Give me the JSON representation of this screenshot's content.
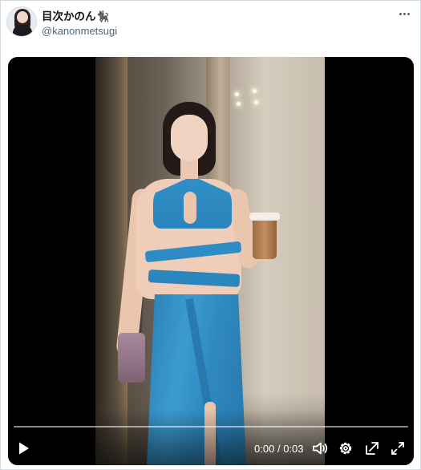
{
  "tweet": {
    "author": {
      "display_name": "目次かのん🐈‍⬛",
      "handle": "@kanonmetsugi"
    },
    "more_icon": "more-horizontal-icon"
  },
  "video": {
    "current_time": "0:00",
    "separator": "/",
    "duration": "0:03",
    "time_text": "0:00 / 0:03",
    "progress": 0.0,
    "controls": {
      "play_icon": "play-icon",
      "volume_icon": "volume-icon",
      "settings_icon": "settings-gear-icon",
      "popout_icon": "picture-in-picture-icon",
      "fullscreen_icon": "fullscreen-icon"
    }
  },
  "colors": {
    "text_primary": "#0f1419",
    "text_secondary": "#536471",
    "border": "#cfd9de",
    "dress_blue": "#2f8fc6"
  }
}
